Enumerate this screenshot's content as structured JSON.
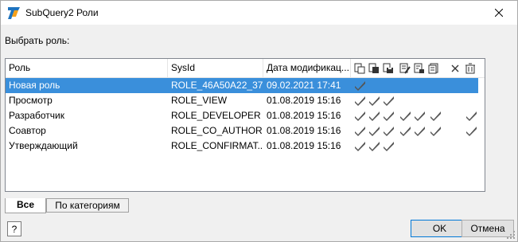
{
  "window": {
    "title": "SubQuery2 Роли"
  },
  "prompt": "Выбрать роль:",
  "grid": {
    "columns": {
      "role": "Роль",
      "sysid": "SysId",
      "date": "Дата модификац..."
    },
    "permission_icons": [
      "perm-read-icon",
      "perm-write-icon",
      "perm-save-icon",
      "perm-edit-icon",
      "perm-edit-all-icon",
      "perm-publish-icon",
      "perm-delete-icon",
      "perm-delete-all-icon"
    ],
    "rows": [
      {
        "role": "Новая роль",
        "sysid": "ROLE_46A50A22_37...",
        "date": "09.02.2021 17:41",
        "checks": [
          true,
          false,
          false,
          false,
          false,
          false,
          false,
          false
        ],
        "selected": true
      },
      {
        "role": "Просмотр",
        "sysid": "ROLE_VIEW",
        "date": "01.08.2019 15:16",
        "checks": [
          true,
          true,
          true,
          false,
          false,
          false,
          false,
          false
        ],
        "selected": false
      },
      {
        "role": "Разработчик",
        "sysid": "ROLE_DEVELOPER",
        "date": "01.08.2019 15:16",
        "checks": [
          true,
          true,
          true,
          true,
          true,
          true,
          false,
          true
        ],
        "selected": false
      },
      {
        "role": "Соавтор",
        "sysid": "ROLE_CO_AUTHOR",
        "date": "01.08.2019 15:16",
        "checks": [
          true,
          true,
          true,
          true,
          true,
          true,
          false,
          true
        ],
        "selected": false
      },
      {
        "role": "Утверждающий",
        "sysid": "ROLE_CONFIRMAT...",
        "date": "01.08.2019 15:16",
        "checks": [
          true,
          true,
          true,
          false,
          false,
          false,
          false,
          false
        ],
        "selected": false
      }
    ]
  },
  "tabs": [
    {
      "label": "Все",
      "active": true
    },
    {
      "label": "По категориям",
      "active": false
    }
  ],
  "buttons": {
    "help": "?",
    "ok": "OK",
    "cancel": "Отмена"
  },
  "colors": {
    "selection": "#3a8fdb",
    "check": "#555555",
    "accent": "#0078d7"
  }
}
